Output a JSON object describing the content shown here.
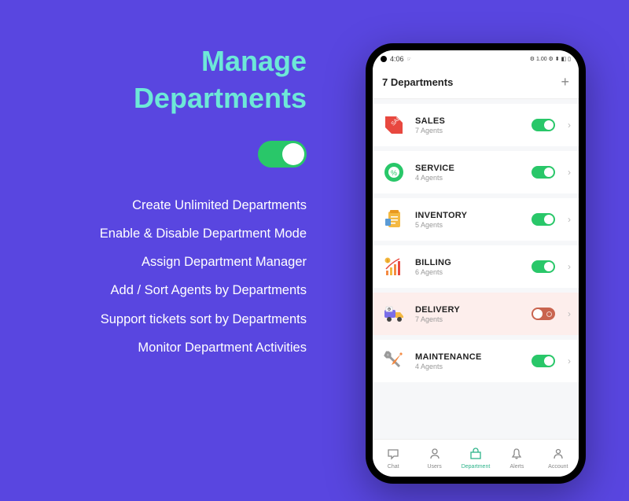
{
  "headline": {
    "line1": "Manage",
    "line2": "Departments"
  },
  "features": [
    "Create Unlimited Departments",
    "Enable & Disable Department Mode",
    "Assign Department Manager",
    "Add / Sort Agents by Departments",
    "Support tickets sort by Departments",
    "Monitor Department Activities"
  ],
  "status": {
    "time": "4:06",
    "indicators": "⚙ 1.00 ⚙ ⬍ ◧ ▯"
  },
  "app": {
    "title": "7 Departments",
    "add": "+"
  },
  "departments": [
    {
      "name": "SALES",
      "agents": "7 Agents",
      "enabled": true,
      "color": "#e8483f"
    },
    {
      "name": "SERVICE",
      "agents": "4 Agents",
      "enabled": true,
      "color": "#29c769"
    },
    {
      "name": "INVENTORY",
      "agents": "5 Agents",
      "enabled": true,
      "color": "#f4b942"
    },
    {
      "name": "BILLING",
      "agents": "6 Agents",
      "enabled": true,
      "color": "#f48a42"
    },
    {
      "name": "DELIVERY",
      "agents": "7 Agents",
      "enabled": false,
      "color": "#7a6de8"
    },
    {
      "name": "MAINTENANCE",
      "agents": "4 Agents",
      "enabled": true,
      "color": "#999"
    }
  ],
  "nav": [
    {
      "label": "Chat",
      "active": false
    },
    {
      "label": "Users",
      "active": false
    },
    {
      "label": "Department",
      "active": true
    },
    {
      "label": "Alerts",
      "active": false
    },
    {
      "label": "Account",
      "active": false
    }
  ]
}
